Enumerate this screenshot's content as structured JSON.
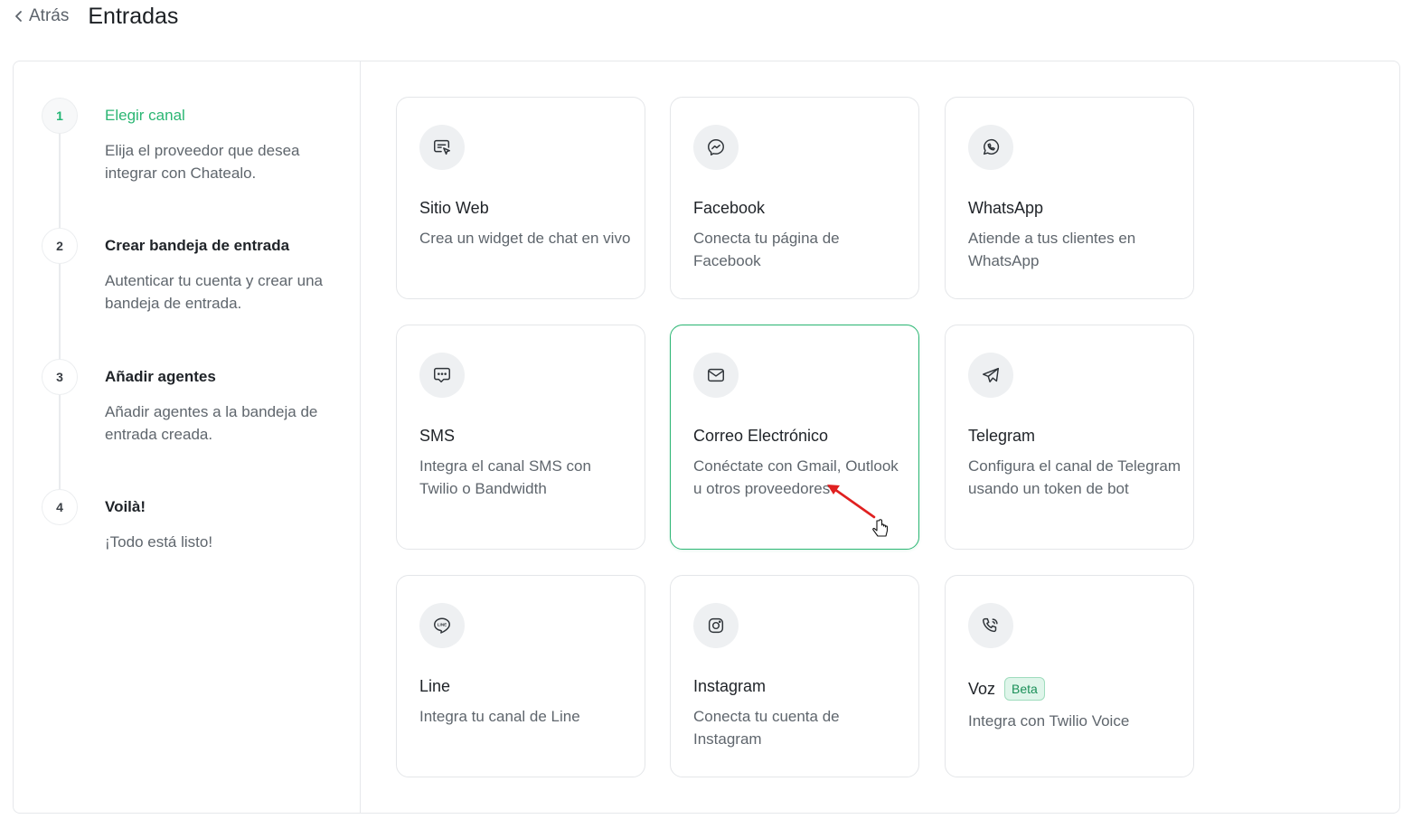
{
  "header": {
    "back_label": "Atrás",
    "title": "Entradas"
  },
  "steps": [
    {
      "number": "1",
      "title": "Elegir canal",
      "description": "Elija el proveedor que desea integrar con Chatealo.",
      "active": true
    },
    {
      "number": "2",
      "title": "Crear bandeja de entrada",
      "description": "Autenticar tu cuenta y crear una bandeja de entrada.",
      "active": false
    },
    {
      "number": "3",
      "title": "Añadir agentes",
      "description": "Añadir agentes a la bandeja de entrada creada.",
      "active": false
    },
    {
      "number": "4",
      "title": "Voilà!",
      "description": "¡Todo está listo!",
      "active": false
    }
  ],
  "channels": [
    {
      "title": "Sitio Web",
      "description": "Crea un widget de chat en vivo",
      "icon": "website-chat-icon"
    },
    {
      "title": "Facebook",
      "description": "Conecta tu página de Facebook",
      "icon": "messenger-icon"
    },
    {
      "title": "WhatsApp",
      "description": "Atiende a tus clientes en WhatsApp",
      "icon": "whatsapp-icon"
    },
    {
      "title": "SMS",
      "description": "Integra el canal SMS con Twilio o Bandwidth",
      "icon": "sms-icon"
    },
    {
      "title": "Correo Electrónico",
      "description": "Conéctate con Gmail, Outlook u otros proveedores",
      "icon": "email-icon",
      "selected": true
    },
    {
      "title": "Telegram",
      "description": "Configura el canal de Telegram usando un token de bot",
      "icon": "telegram-icon"
    },
    {
      "title": "Line",
      "description": "Integra tu canal de Line",
      "icon": "line-icon"
    },
    {
      "title": "Instagram",
      "description": "Conecta tu cuenta de Instagram",
      "icon": "instagram-icon"
    },
    {
      "title": "Voz",
      "badge": "Beta",
      "description": "Integra con Twilio Voice",
      "icon": "phone-call-icon"
    }
  ],
  "colors": {
    "accent": "#2bb673",
    "border": "#e4e6e9",
    "icon_bg": "#eef0f2",
    "annotation_arrow": "#e02020"
  }
}
